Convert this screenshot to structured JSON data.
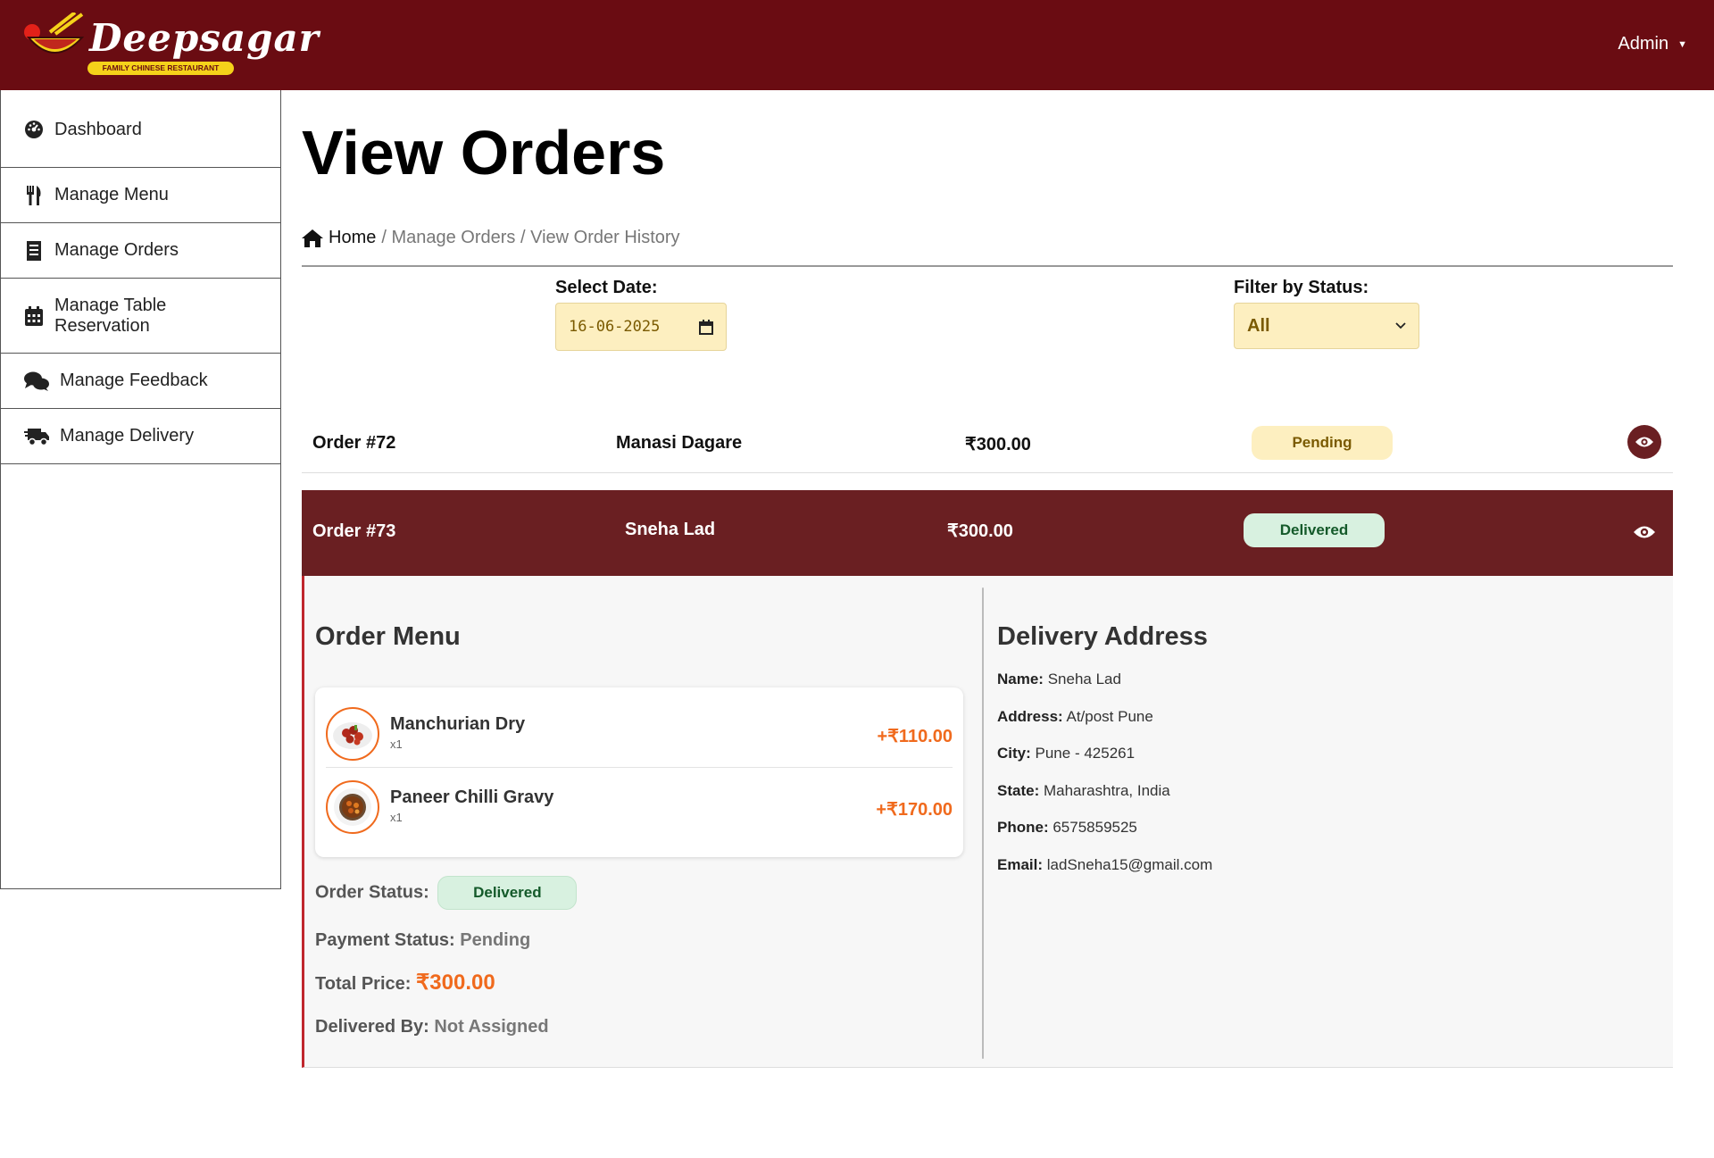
{
  "header": {
    "brand": "Deepsagar",
    "tagline": "FAMILY CHINESE RESTAURANT",
    "user": "Admin"
  },
  "sidebar": {
    "items": [
      {
        "label": "Dashboard",
        "icon": "dashboard-icon"
      },
      {
        "label": "Manage Menu",
        "icon": "utensils-icon"
      },
      {
        "label": "Manage Orders",
        "icon": "receipt-icon"
      },
      {
        "label": "Manage Table Reservation",
        "icon": "calendar-icon"
      },
      {
        "label": "Manage Feedback",
        "icon": "comments-icon"
      },
      {
        "label": "Manage Delivery",
        "icon": "truck-icon"
      }
    ]
  },
  "page": {
    "title": "View Orders",
    "breadcrumb": {
      "home": "Home",
      "rest": "/ Manage Orders / View Order History"
    }
  },
  "filters": {
    "date_label": "Select Date:",
    "date_value": "16-06-2025",
    "status_label": "Filter by Status:",
    "status_value": "All"
  },
  "orders": [
    {
      "id": "Order #72",
      "customer": "Manasi Dagare",
      "amount": "₹300.00",
      "status": "Pending"
    },
    {
      "id": "Order #73",
      "customer": "Sneha Lad",
      "amount": "₹300.00",
      "status": "Delivered"
    }
  ],
  "details": {
    "menu_title": "Order Menu",
    "items": [
      {
        "name": "Manchurian Dry",
        "qty": "x1",
        "price": "+₹110.00"
      },
      {
        "name": "Paneer Chilli Gravy",
        "qty": "x1",
        "price": "+₹170.00"
      }
    ],
    "order_status_label": "Order Status:",
    "order_status": "Delivered",
    "payment_status_label": "Payment Status:",
    "payment_status": "Pending",
    "total_label": "Total Price:",
    "total": "₹300.00",
    "delivered_by_label": "Delivered By:",
    "delivered_by": "Not Assigned",
    "address_title": "Delivery Address",
    "address": {
      "name_label": "Name:",
      "name": "Sneha Lad",
      "address_label": "Address:",
      "address": "At/post Pune",
      "city_label": "City:",
      "city": "Pune - 425261",
      "state_label": "State:",
      "state": "Maharashtra, India",
      "phone_label": "Phone:",
      "phone": "6575859525",
      "email_label": "Email:",
      "email": "ladSneha15@gmail.com"
    }
  },
  "colors": {
    "brand": "#6a0c12",
    "accent": "#f06a1d",
    "pending_bg": "#fdefc0",
    "delivered_bg": "#d8f1e0"
  }
}
